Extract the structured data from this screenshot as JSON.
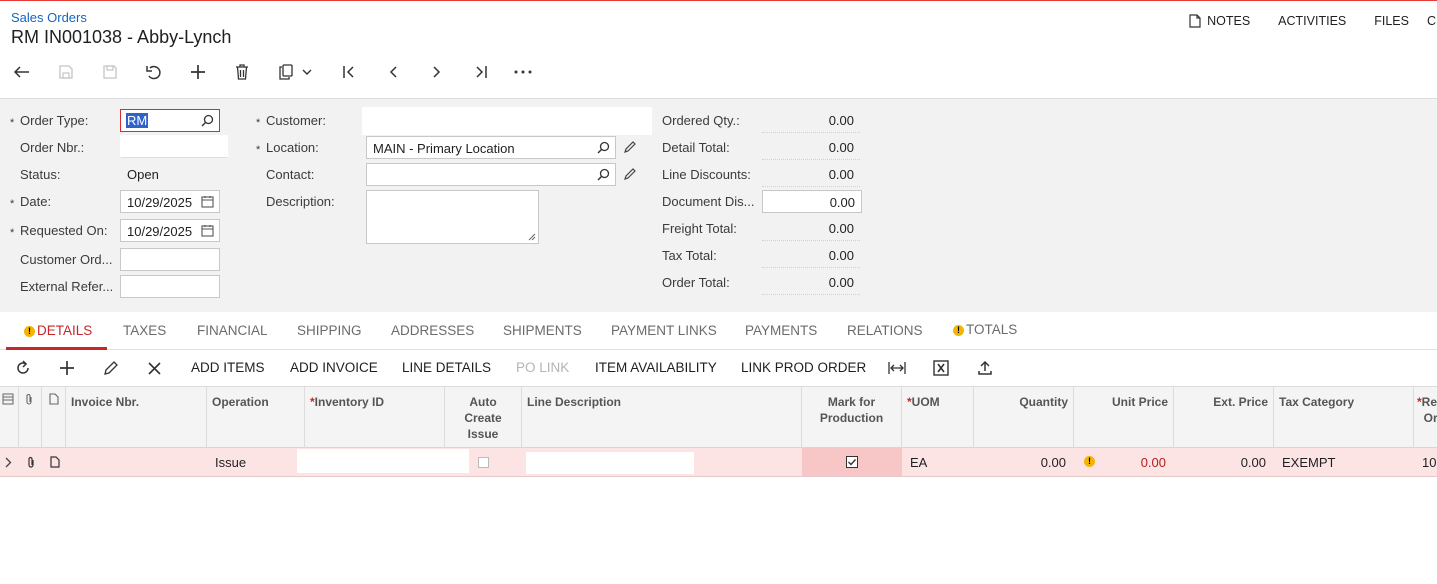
{
  "header": {
    "breadcrumb": "Sales Orders",
    "title": "RM IN001038 - Abby-Lynch",
    "links": [
      "NOTES",
      "ACTIVITIES",
      "FILES",
      "C"
    ]
  },
  "form": {
    "order_type_label": "Order Type:",
    "order_type_value": "RM",
    "order_nbr_label": "Order Nbr.:",
    "status_label": "Status:",
    "status_value": "Open",
    "date_label": "Date:",
    "date_value": "10/29/2025",
    "requested_on_label": "Requested On:",
    "requested_on_value": "10/29/2025",
    "customer_ord_label": "Customer Ord...",
    "external_ref_label": "External Refer...",
    "customer_label": "Customer:",
    "location_label": "Location:",
    "location_value": "MAIN - Primary Location",
    "contact_label": "Contact:",
    "description_label": "Description:",
    "totals": [
      {
        "label": "Ordered Qty.:",
        "value": "0.00"
      },
      {
        "label": "Detail Total:",
        "value": "0.00"
      },
      {
        "label": "Line Discounts:",
        "value": "0.00"
      },
      {
        "label": "Document Dis...",
        "value": "0.00"
      },
      {
        "label": "Freight Total:",
        "value": "0.00"
      },
      {
        "label": "Tax Total:",
        "value": "0.00"
      },
      {
        "label": "Order Total:",
        "value": "0.00"
      }
    ]
  },
  "tabs": [
    "DETAILS",
    "TAXES",
    "FINANCIAL",
    "SHIPPING",
    "ADDRESSES",
    "SHIPMENTS",
    "PAYMENT LINKS",
    "PAYMENTS",
    "RELATIONS",
    "TOTALS"
  ],
  "grid_toolbar": {
    "add_items": "ADD ITEMS",
    "add_invoice": "ADD INVOICE",
    "line_details": "LINE DETAILS",
    "po_link": "PO LINK",
    "item_availability": "ITEM AVAILABILITY",
    "link_prod_order": "LINK PROD ORDER"
  },
  "grid": {
    "columns": {
      "invoice_nbr": "Invoice Nbr.",
      "operation": "Operation",
      "inventory_id": "Inventory ID",
      "auto_create_issue_1": "Auto",
      "auto_create_issue_2": "Create",
      "auto_create_issue_3": "Issue",
      "line_description": "Line Description",
      "mark_for_production_1": "Mark for",
      "mark_for_production_2": "Production",
      "uom": "UOM",
      "quantity": "Quantity",
      "unit_price": "Unit Price",
      "ext_price": "Ext. Price",
      "tax_category": "Tax Category",
      "reason_1": "Re",
      "reason_2": "Or"
    },
    "rows": [
      {
        "operation": "Issue",
        "uom": "EA",
        "quantity": "0.00",
        "unit_price": "0.00",
        "ext_price": "0.00",
        "tax_category": "EXEMPT",
        "reason": "10"
      }
    ]
  }
}
